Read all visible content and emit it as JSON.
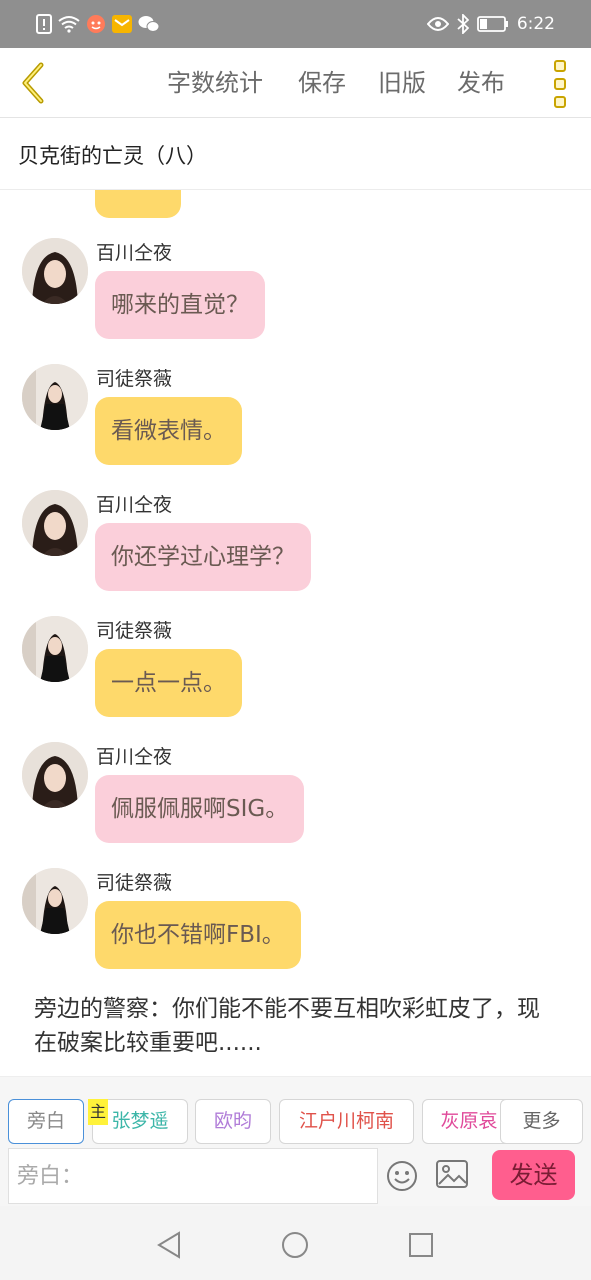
{
  "status_bar": {
    "time": "6:22",
    "icons_left": [
      "alert-icon",
      "wifi-icon",
      "app-notify-icon",
      "mail-notify-icon",
      "wechat-icon"
    ],
    "icons_right": [
      "eye-icon",
      "bluetooth-icon",
      "battery-icon"
    ]
  },
  "toolbar": {
    "actions": {
      "word_count": "字数统计",
      "save": "保存",
      "old_version": "旧版",
      "publish": "发布"
    }
  },
  "title": "贝克街的亡灵（八）",
  "messages": [
    {
      "sender": "百川仝夜",
      "text": "哪来的直觉？",
      "color": "pink"
    },
    {
      "sender": "司徒祭薇",
      "text": "看微表情。",
      "color": "yellow"
    },
    {
      "sender": "百川仝夜",
      "text": "你还学过心理学？",
      "color": "pink"
    },
    {
      "sender": "司徒祭薇",
      "text": "一点一点。",
      "color": "yellow"
    },
    {
      "sender": "百川仝夜",
      "text": "佩服佩服啊SIG。",
      "color": "pink"
    },
    {
      "sender": "司徒祭薇",
      "text": "你也不错啊FBI。",
      "color": "yellow"
    }
  ],
  "narration": "旁边的警察：你们能不能不要互相吹彩虹皮了，现在破案比较重要吧......",
  "roles": {
    "narrator": "旁白",
    "main_badge": "主",
    "items": [
      "张梦遥",
      "欧昀",
      "江户川柯南",
      "灰原哀"
    ],
    "more": "更多"
  },
  "input": {
    "placeholder": "旁白：",
    "send_label": "发送"
  },
  "colors": {
    "pink_bubble": "#fbcfda",
    "yellow_bubble": "#fed96b",
    "send_button": "#ff5e8e",
    "role_zhang": "#3cb6a8",
    "role_ou": "#b07cd8",
    "role_conan": "#e0524a",
    "role_haibara": "#e04a9a"
  }
}
